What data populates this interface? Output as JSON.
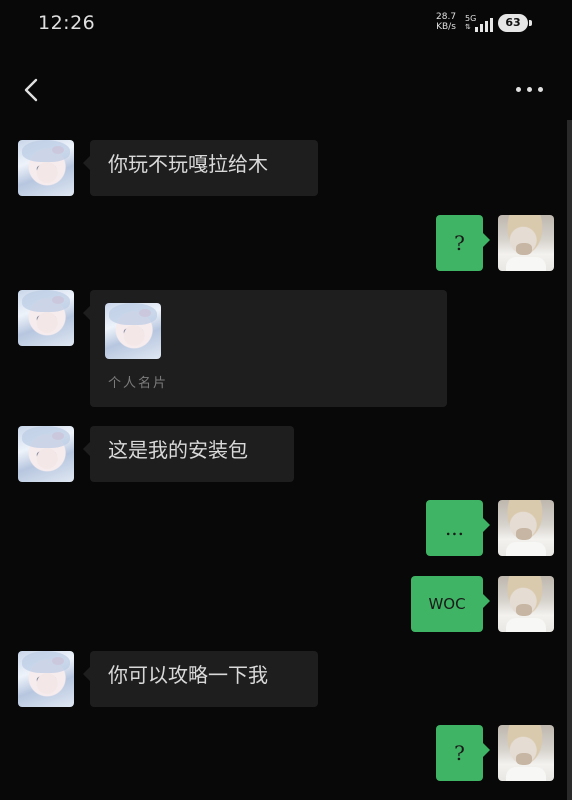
{
  "status_bar": {
    "time": "12:26",
    "net_speed_value": "28.7",
    "net_speed_unit": "KB/s",
    "network_type": "5G",
    "battery": "63"
  },
  "nav": {
    "back_icon": "chevron-left-icon",
    "more_icon": "more-dots-icon"
  },
  "messages": [
    {
      "side": "left",
      "text": "你玩不玩嘎拉给木"
    },
    {
      "side": "right",
      "text": "?"
    },
    {
      "side": "left",
      "type": "contact-card",
      "label": "个人名片"
    },
    {
      "side": "left",
      "text": "这是我的安装包"
    },
    {
      "side": "right",
      "text": "..."
    },
    {
      "side": "right",
      "text": "WOC"
    },
    {
      "side": "left",
      "text": "你可以攻略一下我"
    },
    {
      "side": "right",
      "text": "?"
    }
  ],
  "colors": {
    "background": "#080808",
    "left_bubble": "#1e1e1e",
    "right_bubble": "#3fb464",
    "text": "#d9d9d9"
  }
}
